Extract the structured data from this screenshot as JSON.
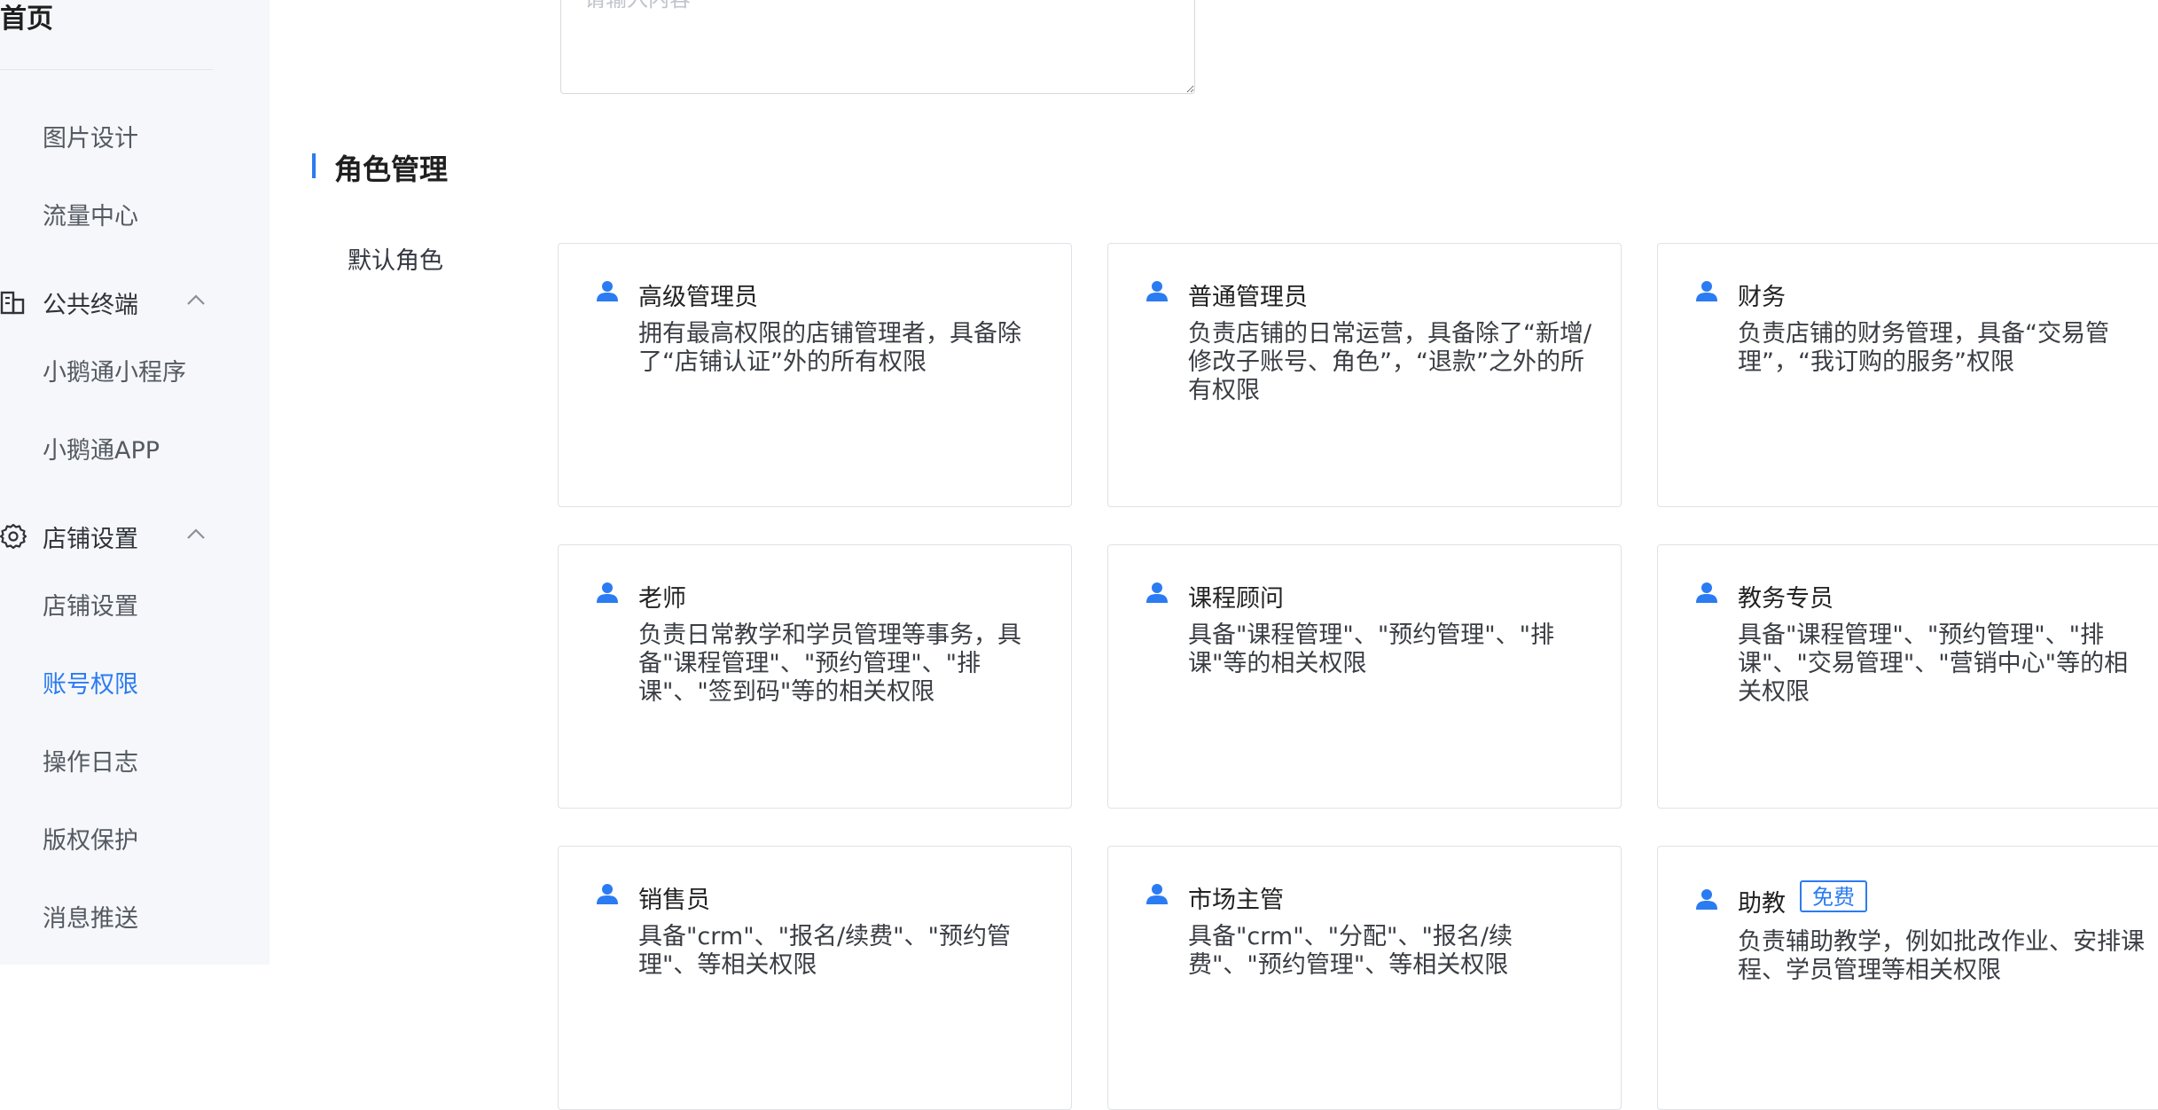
{
  "sidebar": {
    "home": "首页",
    "items_top": [
      "图片设计",
      "流量中心"
    ],
    "groups": [
      {
        "label": "公共终端",
        "icon": "building-icon",
        "items": [
          "小鹅通小程序",
          "小鹅通APP"
        ]
      },
      {
        "label": "店铺设置",
        "icon": "gear-icon",
        "items": [
          "店铺设置",
          "账号权限",
          "操作日志",
          "版权保护",
          "消息推送"
        ]
      }
    ],
    "active_item": "账号权限"
  },
  "form": {
    "textarea_placeholder": "请输入内容"
  },
  "section": {
    "title": "角色管理",
    "field_label": "默认角色"
  },
  "roles": [
    {
      "name": "高级管理员",
      "desc": "拥有最高权限的店铺管理者，具备除了“店铺认证”外的所有权限"
    },
    {
      "name": "普通管理员",
      "desc": "负责店铺的日常运营，具备除了“新增/修改子账号、角色”，“退款”之外的所有权限"
    },
    {
      "name": "财务",
      "desc": "负责店铺的财务管理，具备“交易管理”，“我订购的服务”权限"
    },
    {
      "name": "老师",
      "desc": "负责日常教学和学员管理等事务，具备\"课程管理\"、\"预约管理\"、\"排课\"、\"签到码\"等的相关权限"
    },
    {
      "name": "课程顾问",
      "desc": "具备\"课程管理\"、\"预约管理\"、\"排课\"等的相关权限"
    },
    {
      "name": "教务专员",
      "desc": "具备\"课程管理\"、\"预约管理\"、\"排课\"、\"交易管理\"、\"营销中心\"等的相关权限"
    },
    {
      "name": "销售员",
      "desc": "具备\"crm\"、\"报名/续费\"、\"预约管理\"、等相关权限"
    },
    {
      "name": "市场主管",
      "desc": "具备\"crm\"、\"分配\"、\"报名/续费\"、\"预约管理\"、等相关权限"
    },
    {
      "name": "助教",
      "badge": "免费",
      "desc": "负责辅助教学，例如批改作业、安排课程、学员管理等相关权限"
    }
  ],
  "colors": {
    "accent": "#2b7bf2",
    "sidebar_bg": "#f5f7fa",
    "card_border": "#dfe2e7"
  }
}
